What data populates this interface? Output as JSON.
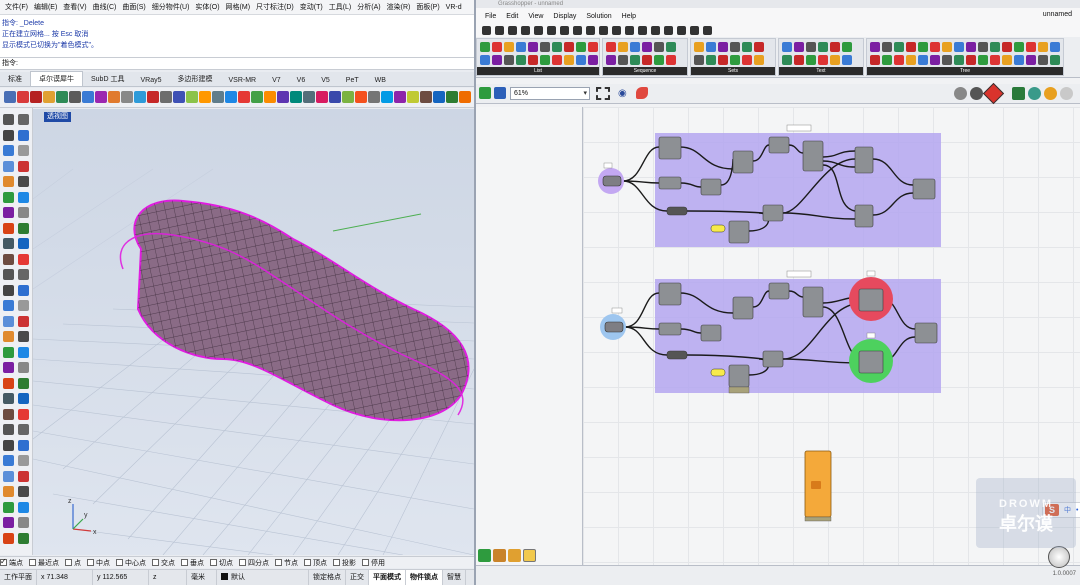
{
  "rhino": {
    "menu": [
      "文件(F)",
      "编辑(E)",
      "查看(V)",
      "曲线(C)",
      "曲面(S)",
      "细分物件(U)",
      "实体(O)",
      "网格(M)",
      "尺寸标注(D)",
      "变动(T)",
      "工具(L)",
      "分析(A)",
      "渲染(R)",
      "面板(P)",
      "VR-d"
    ],
    "command_history": [
      "指令: _Delete",
      "正在建立网格... 按 Esc 取消",
      "显示模式已切换为\"着色模式\"。"
    ],
    "command_prompt": "指令:",
    "tabs": [
      "标准",
      "卓尔谟犀牛",
      "SubD 工具",
      "VRay5",
      "多边形建模",
      "VSR-MR",
      "V7",
      "V6",
      "V5",
      "PeT",
      "WB"
    ],
    "active_tab": "卓尔谟犀牛",
    "viewport_label": "透视图",
    "viewport_axes": {
      "x": "x",
      "y": "y",
      "z": "z"
    },
    "osnaps": [
      {
        "label": "端点",
        "checked": true
      },
      {
        "label": "最近点",
        "checked": false
      },
      {
        "label": "点",
        "checked": false
      },
      {
        "label": "中点",
        "checked": false
      },
      {
        "label": "中心点",
        "checked": false
      },
      {
        "label": "交点",
        "checked": false
      },
      {
        "label": "垂点",
        "checked": false
      },
      {
        "label": "切点",
        "checked": false
      },
      {
        "label": "四分点",
        "checked": false
      },
      {
        "label": "节点",
        "checked": false
      },
      {
        "label": "顶点",
        "checked": false
      },
      {
        "label": "投影",
        "checked": false
      },
      {
        "label": "停用",
        "checked": false
      }
    ],
    "status": {
      "cplane": "工作平面",
      "x": "x 71.348",
      "y": "y 112.565",
      "z": "z",
      "units": "毫米",
      "layer": "默认",
      "toggles": [
        "锁定格点",
        "正交",
        "平面模式",
        "物件锁点",
        "智慧"
      ]
    },
    "colors": {
      "surface": "#8a6b86",
      "edge": "#e01ee0",
      "grid": "#b8c2d2"
    }
  },
  "grasshopper": {
    "title": "Grasshopper - unnamed",
    "menu": [
      "File",
      "Edit",
      "View",
      "Display",
      "Solution",
      "Help"
    ],
    "document_name": "unnamed",
    "ribbon_groups": [
      "List",
      "Sequence",
      "Sets",
      "Text",
      "Tree"
    ],
    "zoom": "61%",
    "version": "1.0.0007",
    "ime_label": "中",
    "watermark": {
      "line1": "DROWM",
      "line2": "卓尔谟"
    },
    "colors": {
      "group": "#b4a6f0",
      "node": "#8d9094",
      "highlight_red": "#e64a5e",
      "highlight_green": "#4dd15e",
      "cluster": "#f4a93a"
    }
  }
}
